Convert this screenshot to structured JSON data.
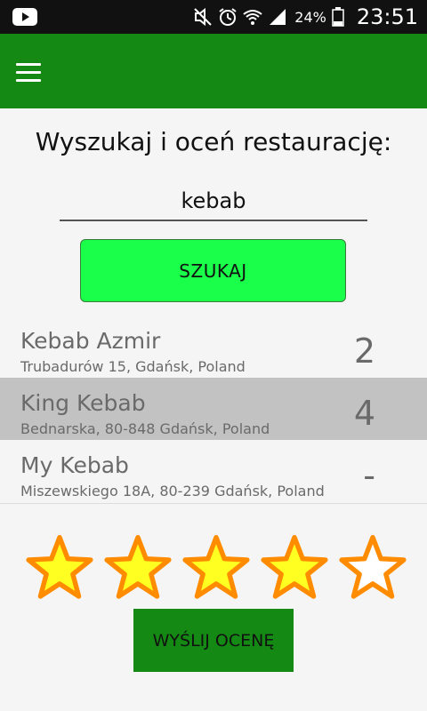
{
  "status_bar": {
    "battery_percent": "24%",
    "time": "23:51",
    "icons": [
      "youtube-icon",
      "silent-icon",
      "alarm-icon",
      "wifi-icon",
      "signal-icon",
      "battery-icon"
    ]
  },
  "app_bar": {
    "menu_icon": "hamburger-menu-icon",
    "color": "#148a14"
  },
  "main": {
    "title": "Wyszukaj i oceń restaurację:",
    "search": {
      "value": "kebab",
      "placeholder": ""
    },
    "search_button_label": "SZUKAJ",
    "results": [
      {
        "name": "Kebab Azmir",
        "address": "Trubadurów 15, Gdańsk, Poland",
        "score": "2",
        "selected": false
      },
      {
        "name": "King Kebab",
        "address": "Bednarska, 80-848 Gdańsk, Poland",
        "score": "4",
        "selected": true
      },
      {
        "name": "My Kebab",
        "address": "Miszewskiego 18A, 80-239 Gdańsk, Poland",
        "score": "-",
        "selected": false
      }
    ],
    "rating": {
      "value": 4,
      "max": 5,
      "filled_color": "#ffff22",
      "outline_color": "#ff8c00"
    },
    "send_button_label": "WYŚLIJ OCENĘ"
  }
}
